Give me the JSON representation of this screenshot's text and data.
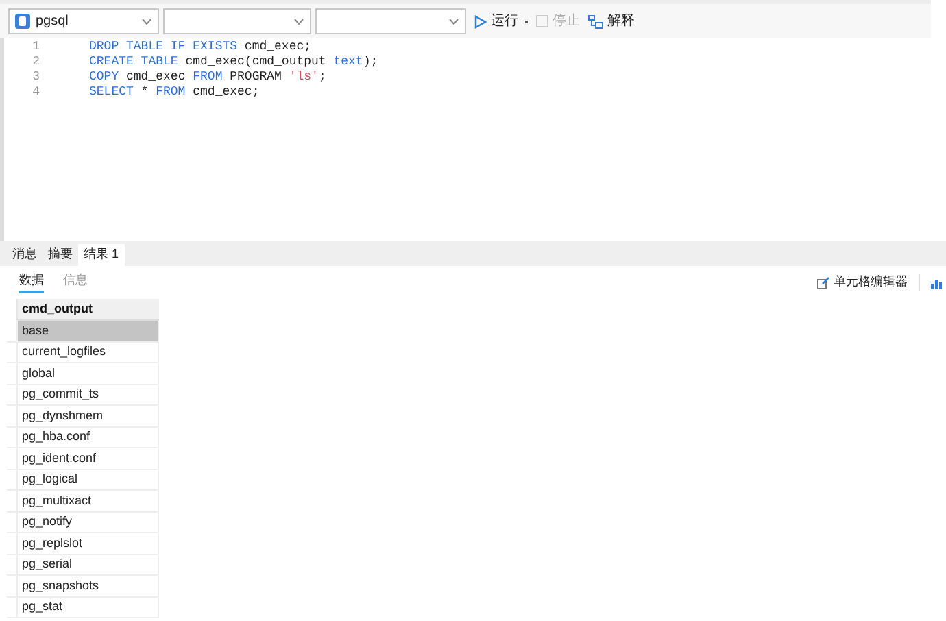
{
  "toolbar": {
    "connection": "pgsql",
    "buttons": [
      {
        "kind": "run",
        "label": "运行",
        "disabled": false
      },
      {
        "kind": "stop",
        "label": "停止",
        "disabled": true
      },
      {
        "kind": "explain",
        "label": "解释",
        "disabled": false
      }
    ]
  },
  "editor": {
    "lines": [
      {
        "number": "1",
        "tokens": [
          {
            "kind": "keyword",
            "text": "DROP TABLE IF EXISTS"
          },
          {
            "kind": "plain",
            "text": " cmd_exec;"
          }
        ]
      },
      {
        "number": "2",
        "tokens": [
          {
            "kind": "keyword",
            "text": "CREATE TABLE"
          },
          {
            "kind": "plain",
            "text": " cmd_exec(cmd_output "
          },
          {
            "kind": "keyword",
            "text": "text"
          },
          {
            "kind": "plain",
            "text": ");"
          }
        ]
      },
      {
        "number": "3",
        "tokens": [
          {
            "kind": "keyword",
            "text": "COPY"
          },
          {
            "kind": "plain",
            "text": " cmd_exec "
          },
          {
            "kind": "keyword",
            "text": "FROM"
          },
          {
            "kind": "plain",
            "text": " PROGRAM "
          },
          {
            "kind": "string",
            "text": "'ls'"
          },
          {
            "kind": "plain",
            "text": ";"
          }
        ]
      },
      {
        "number": "4",
        "tokens": [
          {
            "kind": "keyword",
            "text": "SELECT"
          },
          {
            "kind": "plain",
            "text": " * "
          },
          {
            "kind": "keyword",
            "text": "FROM"
          },
          {
            "kind": "plain",
            "text": " cmd_exec;"
          }
        ]
      }
    ]
  },
  "result_tabs": [
    {
      "label": "消息",
      "selected": false
    },
    {
      "label": "摘要",
      "selected": false
    },
    {
      "label": "结果 1",
      "selected": true
    }
  ],
  "view_tabs": [
    {
      "label": "数据",
      "selected": true
    },
    {
      "label": "信息",
      "selected": false
    }
  ],
  "cell_editor_button": "单元格编辑器",
  "table": {
    "columns": [
      "cmd_output"
    ],
    "rows": [
      {
        "value": "base",
        "selected": true
      },
      {
        "value": "current_logfiles",
        "selected": false
      },
      {
        "value": "global",
        "selected": false
      },
      {
        "value": "pg_commit_ts",
        "selected": false
      },
      {
        "value": "pg_dynshmem",
        "selected": false
      },
      {
        "value": "pg_hba.conf",
        "selected": false
      },
      {
        "value": "pg_ident.conf",
        "selected": false
      },
      {
        "value": "pg_logical",
        "selected": false
      },
      {
        "value": "pg_multixact",
        "selected": false
      },
      {
        "value": "pg_notify",
        "selected": false
      },
      {
        "value": "pg_replslot",
        "selected": false
      },
      {
        "value": "pg_serial",
        "selected": false
      },
      {
        "value": "pg_snapshots",
        "selected": false
      },
      {
        "value": "pg_stat",
        "selected": false
      }
    ]
  }
}
